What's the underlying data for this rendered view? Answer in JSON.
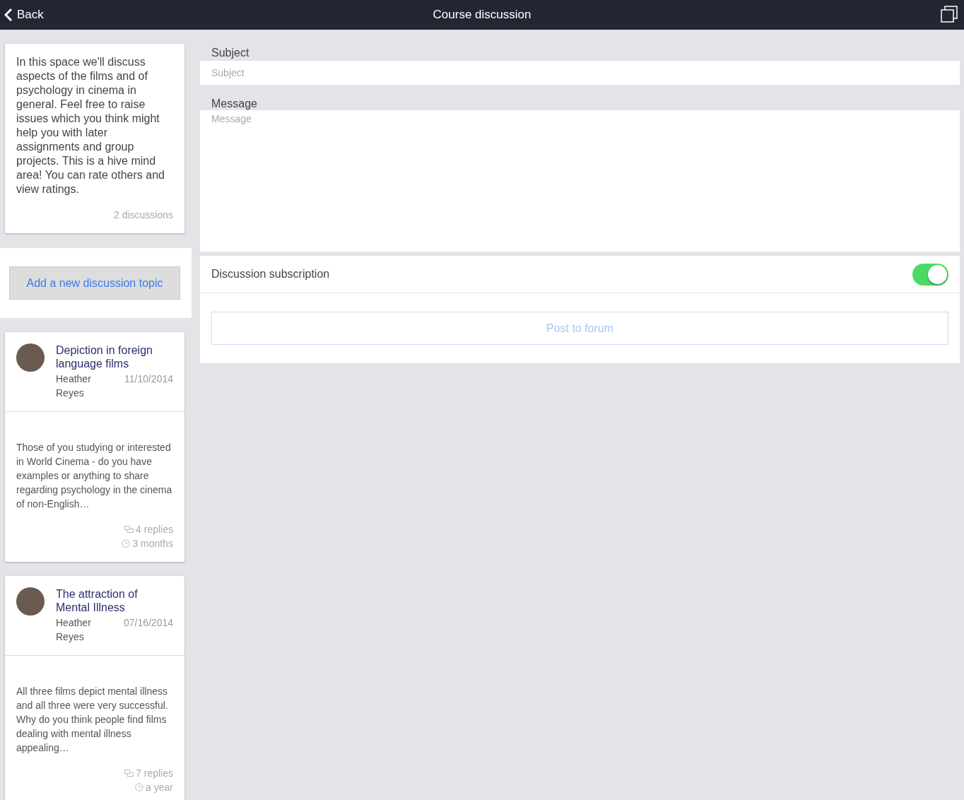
{
  "header": {
    "back": "Back",
    "title": "Course discussion"
  },
  "forum": {
    "intro": "In this space we'll discuss aspects of the films and of psychology in cinema in general. Feel free to raise issues which you think might help you with later assignments and group projects. This is a hive mind area! You can rate others and view ratings.",
    "count": "2 discussions",
    "add_button": "Add a new discussion topic"
  },
  "discussions": [
    {
      "title": "Depiction in foreign language films",
      "author": "Heather Reyes",
      "date": "11/10/2014",
      "excerpt": "Those of you studying or interested in World Cinema - do you have examples or anything to share regarding psychology in the cinema of non-English…",
      "replies": "4 replies",
      "age": "3 months"
    },
    {
      "title": "The attraction of Mental Illness",
      "author": "Heather Reyes",
      "date": "07/16/2014",
      "excerpt": "All three films depict mental illness and all three were very successful. Why do you think people find films dealing with mental illness appealing…",
      "replies": "7 replies",
      "age": "a year"
    }
  ],
  "form": {
    "subject_label": "Subject",
    "subject_placeholder": "Subject",
    "message_label": "Message",
    "message_placeholder": "Message",
    "subscription_label": "Discussion subscription",
    "subscription_on": true,
    "submit": "Post to forum"
  }
}
